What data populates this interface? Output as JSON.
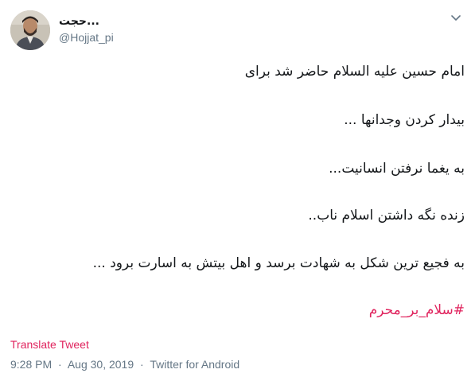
{
  "user": {
    "display_name": "حجت...",
    "handle": "@Hojjat_pi"
  },
  "icons": {
    "avatar": "profile-photo",
    "menu": "chevron-down-icon"
  },
  "tweet": {
    "lines": [
      "امام حسین علیه السلام حاضر شد برای",
      "بیدار کردن وجدانها ...",
      "به یغما نرفتن انسانیت...",
      "زنده نگه داشتن اسلام ناب..",
      "به فجیع ترین شکل به شهادت برسد و اهل بیتش به اسارت برود ..."
    ],
    "hashtag": "#سلام_بر_محرم"
  },
  "translate_label": "Translate Tweet",
  "meta": {
    "time": "9:28 PM",
    "separator": "·",
    "date": "Aug 30, 2019",
    "source": "Twitter for Android"
  },
  "colors": {
    "accent": "#e0245e",
    "text": "#14171a",
    "secondary": "#657786"
  }
}
